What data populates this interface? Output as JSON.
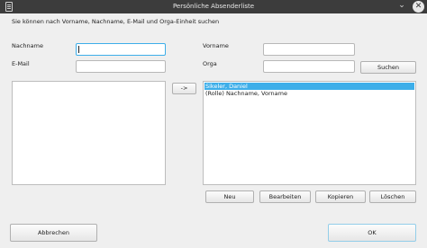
{
  "window": {
    "title": "Persönliche Absenderliste"
  },
  "intro": "Sie können nach Vorname, Nachname, E-Mail und Orga-Einheit suchen",
  "search": {
    "nachname_label": "Nachname",
    "email_label": "E-Mail",
    "vorname_label": "Vorname",
    "orga_label": "Orga",
    "nachname_value": "",
    "email_value": "",
    "vorname_value": "",
    "orga_value": "",
    "search_button": "Suchen"
  },
  "transfer_button": "->",
  "list": {
    "items": [
      {
        "label": "Sikeler, Daniel",
        "selected": true
      },
      {
        "label": "(Rolle) Nachname, Vorname",
        "selected": false
      }
    ]
  },
  "actions": {
    "new": "Neu",
    "edit": "Bearbeiten",
    "copy": "Kopieren",
    "delete": "Löschen"
  },
  "footer": {
    "cancel": "Abbrechen",
    "ok": "OK"
  },
  "colors": {
    "accent": "#3daee9",
    "titlebar": "#3c3c3c"
  },
  "icons": {
    "window": "address-list-icon",
    "close": "close-icon",
    "menu": "chevron-down-icon"
  }
}
